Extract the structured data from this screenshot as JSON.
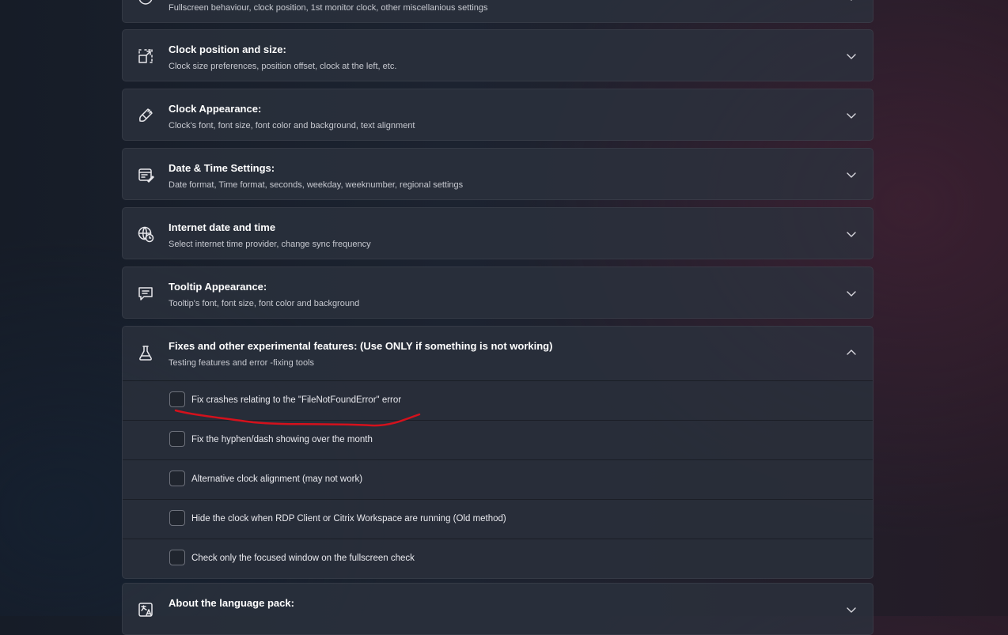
{
  "sections": [
    {
      "title": "",
      "subtitle": "Fullscreen behaviour, clock position, 1st monitor clock, other miscellanious settings",
      "icon": "settings-circle-icon"
    },
    {
      "title": "Clock position and size:",
      "subtitle": "Clock size preferences, position offset, clock at the left, etc.",
      "icon": "resize-icon"
    },
    {
      "title": "Clock Appearance:",
      "subtitle": "Clock's font, font size, font color and background, text alignment",
      "icon": "paintbrush-icon"
    },
    {
      "title": "Date & Time Settings:",
      "subtitle": "Date format, Time format, seconds, weekday, weeknumber, regional settings",
      "icon": "calendar-edit-icon"
    },
    {
      "title": "Internet date and time",
      "subtitle": "Select internet time provider, change sync frequency",
      "icon": "globe-clock-icon"
    },
    {
      "title": "Tooltip Appearance:",
      "subtitle": "Tooltip's font, font size, font color and background",
      "icon": "chat-bubble-icon"
    }
  ],
  "experimental": {
    "title": "Fixes and other experimental features: (Use ONLY if something is not working)",
    "subtitle": "Testing features and error -fixing tools",
    "icon": "flask-icon",
    "expanded": true,
    "options": [
      {
        "label": "Fix crashes relating to the \"FileNotFoundError\" error",
        "checked": false
      },
      {
        "label": "Fix the hyphen/dash showing over the month",
        "checked": false
      },
      {
        "label": "Alternative clock alignment (may not work)",
        "checked": false
      },
      {
        "label": "Hide the clock when RDP Client or Citrix Workspace are running (Old method)",
        "checked": false
      },
      {
        "label": "Check only the focused window on the fullscreen check",
        "checked": false
      }
    ]
  },
  "language_pack": {
    "title": "About the language pack:",
    "icon": "language-icon"
  },
  "colors": {
    "annotation_stroke": "#d4111c",
    "card_background": "#2c323e",
    "accent_text": "#ffffff",
    "secondary_text": "#c7c9d0"
  }
}
